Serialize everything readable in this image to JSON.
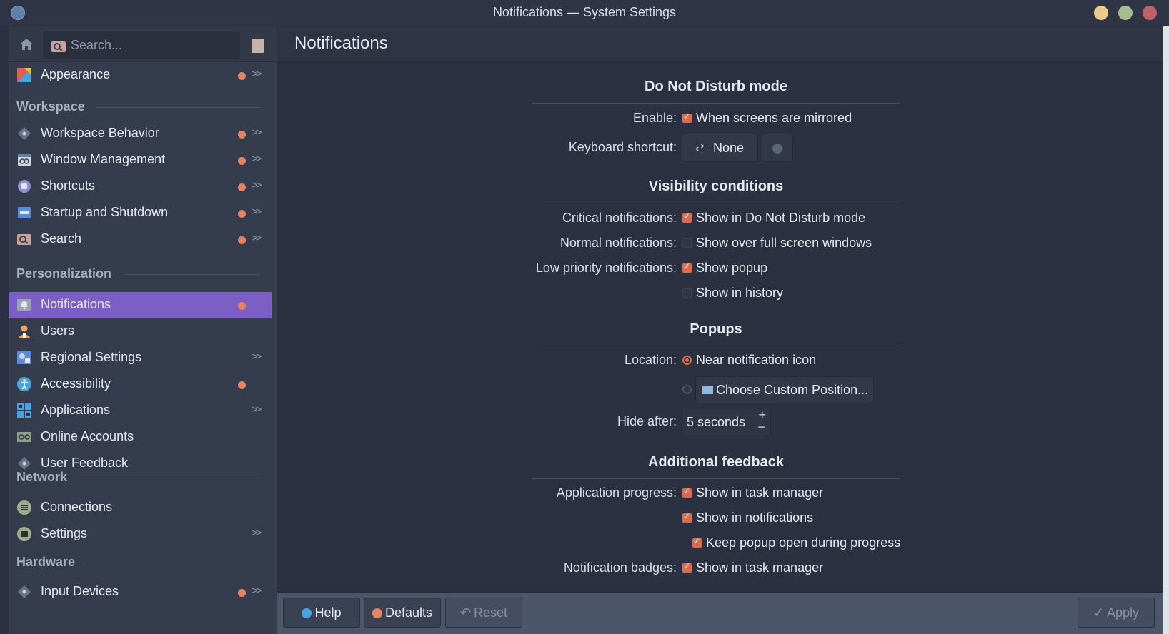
{
  "window": {
    "title": "Notifications — System Settings"
  },
  "sidebar": {
    "search_placeholder": "Search...",
    "top_items": [
      {
        "label": "Appearance",
        "icon": "appearance-icon",
        "modified": true,
        "has_children": true
      }
    ],
    "sections": [
      {
        "title": "Workspace",
        "items": [
          {
            "label": "Workspace Behavior",
            "icon": "workspace-behavior-icon",
            "modified": true,
            "has_children": true
          },
          {
            "label": "Window Management",
            "icon": "window-management-icon",
            "modified": true,
            "has_children": true
          },
          {
            "label": "Shortcuts",
            "icon": "shortcuts-icon",
            "modified": true,
            "has_children": true
          },
          {
            "label": "Startup and Shutdown",
            "icon": "startup-shutdown-icon",
            "modified": true,
            "has_children": true
          },
          {
            "label": "Search",
            "icon": "search-icon",
            "modified": true,
            "has_children": true
          }
        ]
      },
      {
        "title": "Personalization",
        "items": [
          {
            "label": "Notifications",
            "icon": "notifications-icon",
            "modified": true,
            "has_children": false,
            "active": true
          },
          {
            "label": "Users",
            "icon": "users-icon",
            "modified": false,
            "has_children": false
          },
          {
            "label": "Regional Settings",
            "icon": "regional-settings-icon",
            "modified": false,
            "has_children": true
          },
          {
            "label": "Accessibility",
            "icon": "accessibility-icon",
            "modified": true,
            "has_children": false
          },
          {
            "label": "Applications",
            "icon": "applications-icon",
            "modified": false,
            "has_children": true
          },
          {
            "label": "Online Accounts",
            "icon": "online-accounts-icon",
            "modified": false,
            "has_children": false
          },
          {
            "label": "User Feedback",
            "icon": "user-feedback-icon",
            "modified": false,
            "has_children": false
          }
        ]
      },
      {
        "title": "Network",
        "items": [
          {
            "label": "Connections",
            "icon": "connections-icon",
            "modified": false,
            "has_children": false
          },
          {
            "label": "Settings",
            "icon": "network-settings-icon",
            "modified": false,
            "has_children": true
          }
        ]
      },
      {
        "title": "Hardware",
        "items": [
          {
            "label": "Input Devices",
            "icon": "input-devices-icon",
            "modified": true,
            "has_children": true
          }
        ]
      }
    ]
  },
  "page": {
    "title": "Notifications"
  },
  "dnd": {
    "title": "Do Not Disturb mode",
    "enable_label": "Enable:",
    "enable_text": "When screens are mirrored",
    "enable_checked": true,
    "shortcut_label": "Keyboard shortcut:",
    "shortcut_value": "None"
  },
  "visibility": {
    "title": "Visibility conditions",
    "critical_label": "Critical notifications:",
    "critical_text": "Show in Do Not Disturb mode",
    "critical_checked": true,
    "normal_label": "Normal notifications:",
    "normal_text": "Show over full screen windows",
    "normal_checked": false,
    "low_label": "Low priority notifications:",
    "low_popup_text": "Show popup",
    "low_popup_checked": true,
    "low_history_text": "Show in history",
    "low_history_checked": false
  },
  "popups": {
    "title": "Popups",
    "location_label": "Location:",
    "near_icon_text": "Near notification icon",
    "near_icon_selected": true,
    "custom_button": "Choose Custom Position...",
    "hide_after_label": "Hide after:",
    "hide_after_value": "5 seconds"
  },
  "feedback": {
    "title": "Additional feedback",
    "app_progress_label": "Application progress:",
    "task_manager_text": "Show in task manager",
    "task_manager_checked": true,
    "in_notifications_text": "Show in notifications",
    "in_notifications_checked": true,
    "keep_open_text": "Keep popup open during progress",
    "keep_open_checked": true,
    "badges_label": "Notification badges:",
    "badges_text": "Show in task manager",
    "badges_checked": true
  },
  "footer": {
    "help": "Help",
    "defaults": "Defaults",
    "reset": "Reset",
    "apply": "Apply"
  },
  "colors": {
    "accent": "#7c5fc4",
    "highlight": "#e3694b",
    "modified_dot": "#e48664",
    "background": "#2b3140"
  }
}
